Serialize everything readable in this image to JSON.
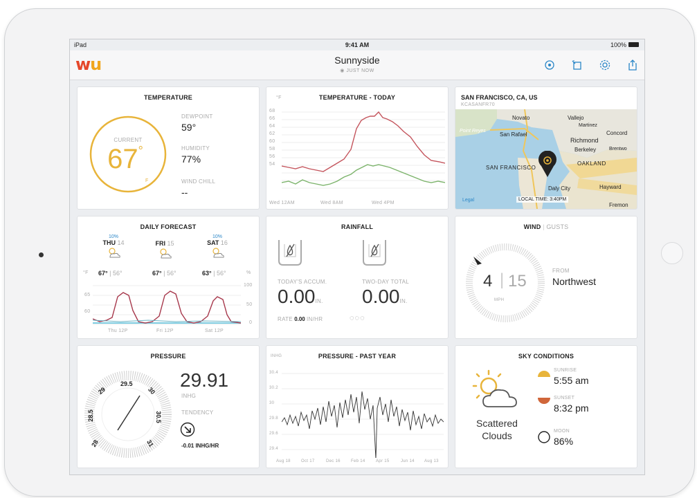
{
  "status": {
    "device": "iPad",
    "time": "9:41 AM",
    "battery": "100%"
  },
  "nav": {
    "title": "Sunnyside",
    "subtitle": "JUST NOW"
  },
  "temperature": {
    "title": "TEMPERATURE",
    "current_label": "CURRENT",
    "current_value": "67",
    "unit": "F",
    "dewpoint_label": "DEWPOINT",
    "dewpoint_value": "59°",
    "humidity_label": "HUMIDITY",
    "humidity_value": "77%",
    "windchill_label": "WIND CHILL",
    "windchill_value": "--"
  },
  "temp_today": {
    "title": "TEMPERATURE - TODAY",
    "unit": "°F",
    "y_ticks": [
      "68",
      "66",
      "64",
      "62",
      "60",
      "58",
      "56",
      "54"
    ],
    "x_ticks": [
      "Wed 12AM",
      "Wed 8AM",
      "Wed 4PM"
    ]
  },
  "map": {
    "title": "SAN FRANCISCO, CA, US",
    "station": "KCASANFR70",
    "places": [
      "Novato",
      "Vallejo",
      "Martinez",
      "Point Reyes",
      "San Rafael",
      "Concord",
      "Richmond",
      "Berkeley",
      "Brentwo",
      "SAN FRANCISCO",
      "OAKLAND",
      "Daly City",
      "Hayward",
      "Fremon"
    ],
    "legal": "Legal",
    "local_time": "LOCAL TIME: 3:40PM"
  },
  "forecast": {
    "title": "DAILY FORECAST",
    "days": [
      {
        "day": "THU",
        "date": "14",
        "precip": "10%",
        "hi": "67°",
        "lo": "56°"
      },
      {
        "day": "FRI",
        "date": "15",
        "precip": "",
        "hi": "67°",
        "lo": "56°"
      },
      {
        "day": "SAT",
        "date": "16",
        "precip": "10%",
        "hi": "63°",
        "lo": "56°"
      }
    ],
    "unit_left": "°F",
    "unit_right": "%",
    "y_left": [
      "65",
      "60"
    ],
    "y_right": [
      "100",
      "50",
      "0"
    ],
    "x_ticks": [
      "Thu 12P",
      "Fri 12P",
      "Sat 12P"
    ]
  },
  "rainfall": {
    "title": "RAINFALL",
    "today_label": "TODAY'S ACCUM.",
    "today_value": "0.00",
    "today_unit": "IN.",
    "twoday_label": "TWO-DAY TOTAL",
    "twoday_value": "0.00",
    "twoday_unit": "IN.",
    "rate_label": "RATE",
    "rate_value": "0.00",
    "rate_unit": "IN/HR"
  },
  "wind": {
    "title": "WIND",
    "gusts": "GUSTS",
    "speed": "4",
    "gust_speed": "15",
    "unit": "MPH",
    "from_label": "FROM",
    "from_value": "Northwest"
  },
  "pressure": {
    "title": "PRESSURE",
    "value": "29.91",
    "unit": "INHG",
    "tendency_label": "TENDENCY",
    "tendency_value": "-0.01 INHG/HR",
    "dial_labels": [
      "28",
      "28.5",
      "29",
      "29.5",
      "30",
      "30.5",
      "31"
    ]
  },
  "pressure_year": {
    "title": "PRESSURE - PAST YEAR",
    "unit": "INHG",
    "y_ticks": [
      "30.4",
      "30.2",
      "30",
      "29.8",
      "29.6",
      "29.4"
    ],
    "x_ticks": [
      "Aug 18",
      "Oct 17",
      "Dec 16",
      "Feb 14",
      "Apr 15",
      "Jun 14",
      "Aug 13"
    ]
  },
  "sky": {
    "title": "SKY CONDITIONS",
    "condition_line1": "Scattered",
    "condition_line2": "Clouds",
    "sunrise_label": "SUNRISE",
    "sunrise_value": "5:55 am",
    "sunset_label": "SUNSET",
    "sunset_value": "8:32 pm",
    "moon_label": "MOON",
    "moon_value": "86%"
  },
  "colors": {
    "accent": "#e8b43a",
    "blue": "#2a86c7",
    "red_line": "#c4545c",
    "green_line": "#7bb36a",
    "brand_red": "#e5472a"
  }
}
